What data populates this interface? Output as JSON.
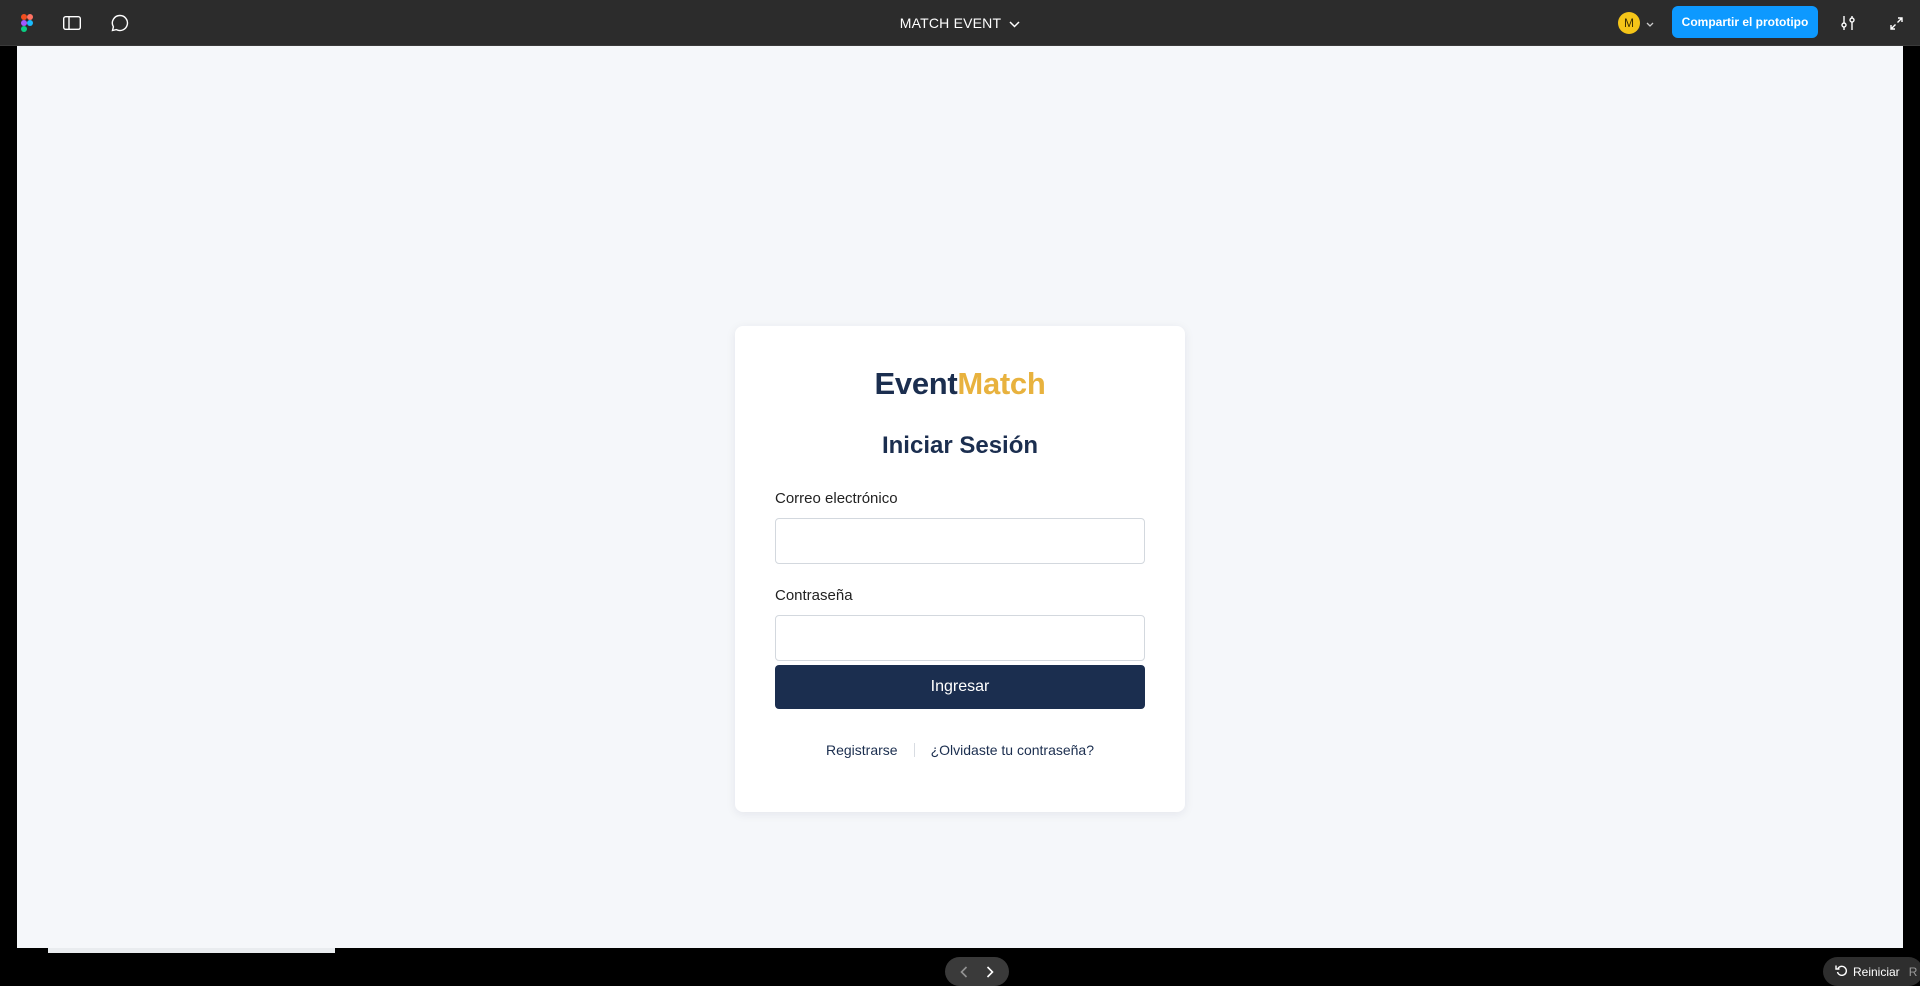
{
  "toolbar": {
    "file_title": "MATCH EVENT",
    "avatar_initial": "M",
    "share_label": "Compartir el prototipo",
    "accent_color": "#0d99ff"
  },
  "login": {
    "logo_part1": "Event",
    "logo_part2": "Match",
    "title": "Iniciar Sesión",
    "email_label": "Correo electrónico",
    "email_value": "",
    "password_label": "Contraseña",
    "password_value": "",
    "submit_label": "Ingresar",
    "register_link": "Registrarse",
    "forgot_link": "¿Olvidaste tu contraseña?",
    "brand_navy": "#1b2e4f",
    "brand_gold": "#e8b23e"
  },
  "player": {
    "restart_label": "Reiniciar",
    "restart_shortcut": "R"
  }
}
